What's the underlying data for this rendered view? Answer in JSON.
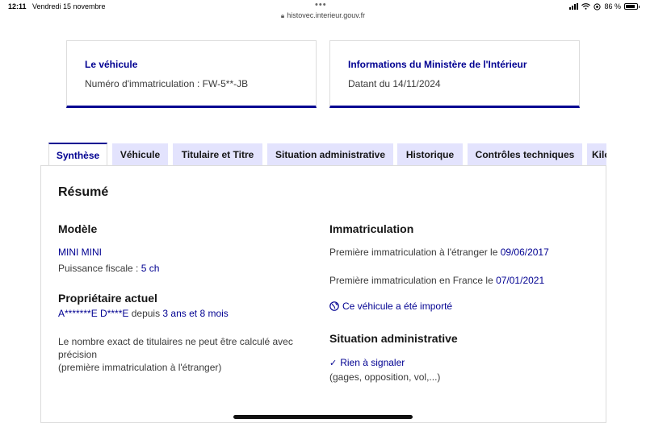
{
  "status_bar": {
    "time": "12:11",
    "date": "Vendredi 15 novembre",
    "battery": "86 %",
    "battery_level": 0.86
  },
  "browser": {
    "url": "histovec.interieur.gouv.fr"
  },
  "vehicle_card": {
    "title": "Le véhicule",
    "text": "Numéro d'immatriculation : FW-5**-JB"
  },
  "ministry_card": {
    "title": "Informations du Ministère de l'Intérieur",
    "text": "Datant du 14/11/2024"
  },
  "tabs": [
    {
      "label": "Synthèse"
    },
    {
      "label": "Véhicule"
    },
    {
      "label": "Titulaire et Titre"
    },
    {
      "label": "Situation administrative"
    },
    {
      "label": "Historique"
    },
    {
      "label": "Contrôles techniques"
    },
    {
      "label": "Kilo"
    }
  ],
  "summary": {
    "title": "Résumé",
    "model": {
      "heading": "Modèle",
      "name": "MINI MINI",
      "power_label": "Puissance fiscale : ",
      "power_value": "5 ch"
    },
    "owner": {
      "heading": "Propriétaire actuel",
      "name": "A*******E D****E",
      "since_label": " depuis ",
      "since_value": "3 ans et 8 mois",
      "note_line1": "Le nombre exact de titulaires ne peut être calculé avec",
      "note_line2": "précision",
      "note_line3": "(première immatriculation à l'étranger)"
    },
    "registration": {
      "heading": "Immatriculation",
      "foreign_label": "Première immatriculation à l'étranger le ",
      "foreign_date": "09/06/2017",
      "france_label": "Première immatriculation en France le ",
      "france_date": "07/01/2021",
      "imported": "Ce véhicule a été importé"
    },
    "admin": {
      "heading": "Situation administrative",
      "status": "Rien à signaler",
      "detail": "(gages, opposition, vol,...)"
    }
  },
  "colors": {
    "accent": "#000091",
    "tab_background": "#e3e3fd"
  }
}
